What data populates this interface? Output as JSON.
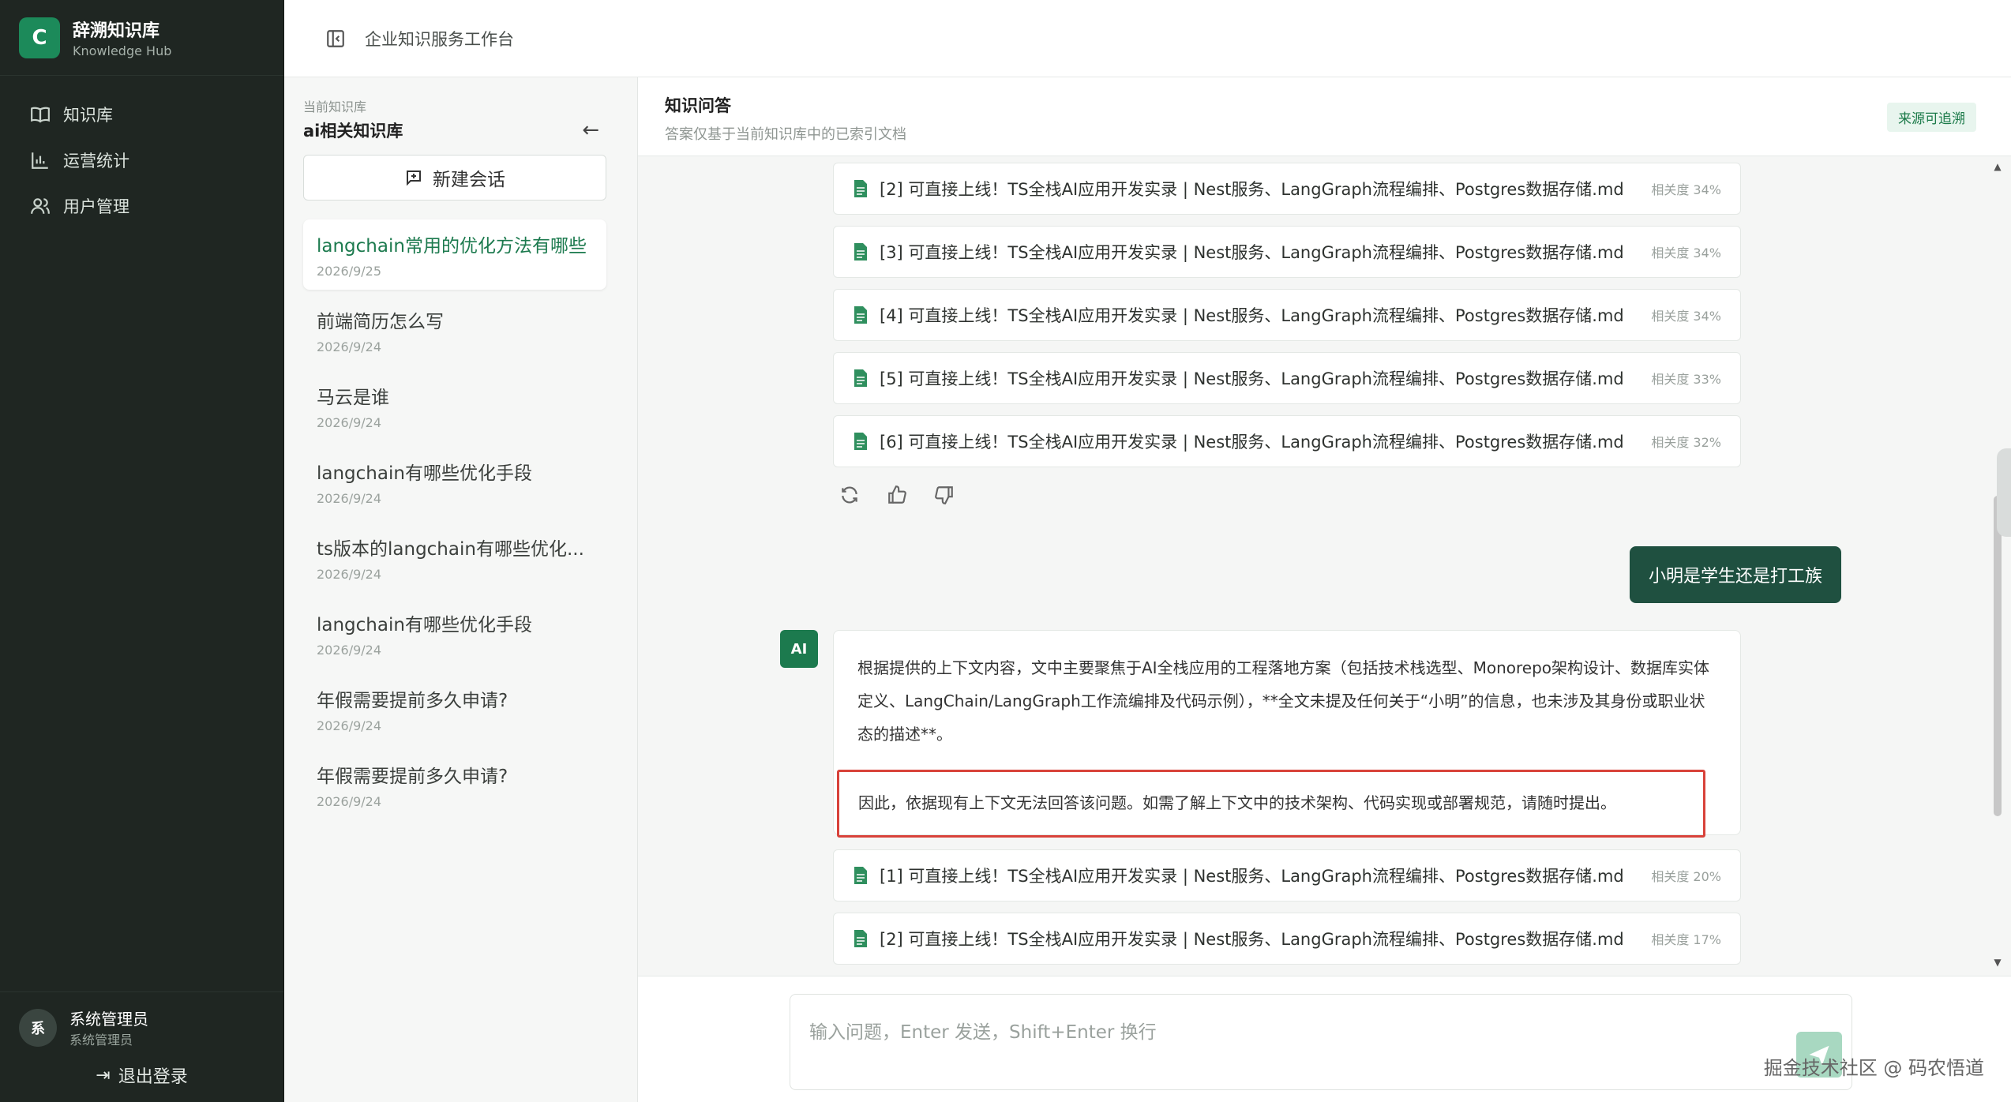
{
  "brand": {
    "logo_letter": "C",
    "title": "辞溯知识库",
    "subtitle": "Knowledge Hub"
  },
  "nav": [
    {
      "label": "知识库",
      "icon": "book-icon"
    },
    {
      "label": "运营统计",
      "icon": "bar-chart-icon"
    },
    {
      "label": "用户管理",
      "icon": "users-icon"
    }
  ],
  "user": {
    "avatar": "系",
    "name": "系统管理员",
    "role": "系统管理员",
    "logout": "退出登录"
  },
  "topbar": {
    "title": "企业知识服务工作台"
  },
  "conv_panel": {
    "kb_label": "当前知识库",
    "kb_name": "ai相关知识库",
    "new_chat": "新建会话",
    "items": [
      {
        "q": "langchain常用的优化方法有哪些",
        "d": "2026/9/25"
      },
      {
        "q": "前端简历怎么写",
        "d": "2026/9/24"
      },
      {
        "q": "马云是谁",
        "d": "2026/9/24"
      },
      {
        "q": "langchain有哪些优化手段",
        "d": "2026/9/24"
      },
      {
        "q": "ts版本的langchain有哪些优化...",
        "d": "2026/9/24"
      },
      {
        "q": "langchain有哪些优化手段",
        "d": "2026/9/24"
      },
      {
        "q": "年假需要提前多久申请?",
        "d": "2026/9/24"
      },
      {
        "q": "年假需要提前多久申请?",
        "d": "2026/9/24"
      }
    ]
  },
  "chat": {
    "title": "知识问答",
    "subtitle": "答案仅基于当前知识库中的已索引文档",
    "badge": "来源可追溯",
    "sources_top": [
      {
        "text": "[2] 可直接上线！TS全栈AI应用开发实录 | Nest服务、LangGraph流程编排、Postgres数据存储.md",
        "rel": "相关度 34%"
      },
      {
        "text": "[3] 可直接上线！TS全栈AI应用开发实录 | Nest服务、LangGraph流程编排、Postgres数据存储.md",
        "rel": "相关度 34%"
      },
      {
        "text": "[4] 可直接上线！TS全栈AI应用开发实录 | Nest服务、LangGraph流程编排、Postgres数据存储.md",
        "rel": "相关度 34%"
      },
      {
        "text": "[5] 可直接上线！TS全栈AI应用开发实录 | Nest服务、LangGraph流程编排、Postgres数据存储.md",
        "rel": "相关度 33%"
      },
      {
        "text": "[6] 可直接上线！TS全栈AI应用开发实录 | Nest服务、LangGraph流程编排、Postgres数据存储.md",
        "rel": "相关度 32%"
      }
    ],
    "user_message": "小明是学生还是打工族",
    "ai_badge": "AI",
    "ai_para1": "根据提供的上下文内容，文中主要聚焦于AI全栈应用的工程落地方案（包括技术栈选型、Monorepo架构设计、数据库实体定义、LangChain/LangGraph工作流编排及代码示例），**全文未提及任何关于“小明”的信息，也未涉及其身份或职业状态的描述**。",
    "ai_para2": "因此，依据现有上下文无法回答该问题。如需了解上下文中的技术架构、代码实现或部署规范，请随时提出。",
    "sources_bottom": [
      {
        "text": "[1] 可直接上线！TS全栈AI应用开发实录 | Nest服务、LangGraph流程编排、Postgres数据存储.md",
        "rel": "相关度 20%"
      },
      {
        "text": "[2] 可直接上线！TS全栈AI应用开发实录 | Nest服务、LangGraph流程编排、Postgres数据存储.md",
        "rel": "相关度 17%"
      }
    ],
    "input_placeholder": "输入问题，Enter 发送，Shift+Enter 换行"
  },
  "watermark": "掘金技术社区 @ 码农悟道",
  "colors": {
    "sidebar_bg": "#1f2622",
    "accent": "#1c7a4e",
    "user_bubble": "#1f5040",
    "highlight_border": "#d8423a"
  }
}
